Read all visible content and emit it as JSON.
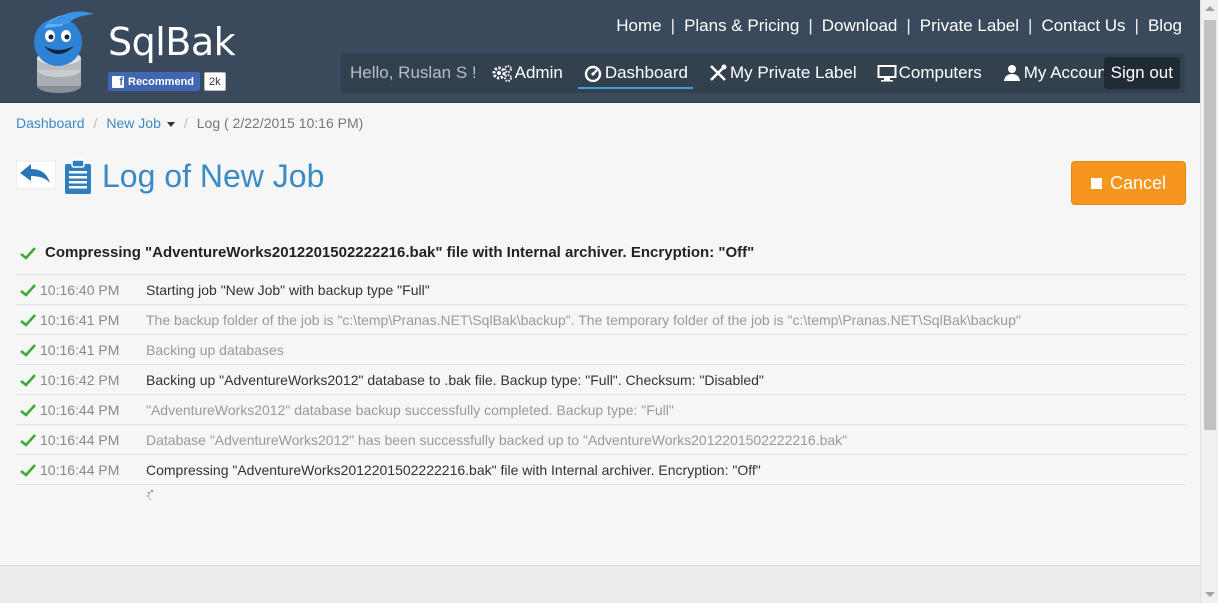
{
  "brand": {
    "name": "SqlBak"
  },
  "facebook": {
    "label": "Recommend",
    "count": "2k"
  },
  "top_nav": [
    "Home",
    "Plans & Pricing",
    "Download",
    "Private Label",
    "Contact Us",
    "Blog"
  ],
  "sub_nav": {
    "greeting": "Hello, Ruslan S !",
    "items": [
      {
        "label": "Admin",
        "icon": "gears-icon"
      },
      {
        "label": "Dashboard",
        "icon": "dashboard-icon",
        "active": true
      },
      {
        "label": "My Private Label",
        "icon": "tools-icon"
      },
      {
        "label": "Computers",
        "icon": "monitor-icon"
      },
      {
        "label": "My Account",
        "icon": "user-icon"
      }
    ],
    "signout": "Sign out"
  },
  "breadcrumb": {
    "dashboard": "Dashboard",
    "job": "New Job",
    "current": "Log ( 2/22/2015 10:16 PM)"
  },
  "page": {
    "title": "Log of New Job",
    "cancel_label": "Cancel"
  },
  "status": "Compressing \"AdventureWorks2012201502222216.bak\" file with Internal archiver. Encryption: \"Off\"",
  "log": [
    {
      "time": "10:16:40 PM",
      "message": "Starting job \"New Job\" with backup type \"Full\"",
      "dim": false
    },
    {
      "time": "10:16:41 PM",
      "message": "The backup folder of the job is \"c:\\temp\\Pranas.NET\\SqlBak\\backup\". The temporary folder of the job is \"c:\\temp\\Pranas.NET\\SqlBak\\backup\"",
      "dim": true
    },
    {
      "time": "10:16:41 PM",
      "message": "Backing up databases",
      "dim": true
    },
    {
      "time": "10:16:42 PM",
      "message": "Backing up \"AdventureWorks2012\" database to .bak file. Backup type: \"Full\". Checksum: \"Disabled\"",
      "dim": false
    },
    {
      "time": "10:16:44 PM",
      "message": "\"AdventureWorks2012\" database backup successfully completed. Backup type: \"Full\"",
      "dim": true
    },
    {
      "time": "10:16:44 PM",
      "message": "Database \"AdventureWorks2012\" has been successfully backed up to \"AdventureWorks2012201502222216.bak\"",
      "dim": true
    },
    {
      "time": "10:16:44 PM",
      "message": "Compressing \"AdventureWorks2012201502222216.bak\" file with Internal archiver. Encryption: \"Off\"",
      "dim": false
    }
  ],
  "colors": {
    "header": "#3a4a5c",
    "accent": "#3a8ac4",
    "cancel": "#f7961f",
    "check": "#3aa935"
  }
}
